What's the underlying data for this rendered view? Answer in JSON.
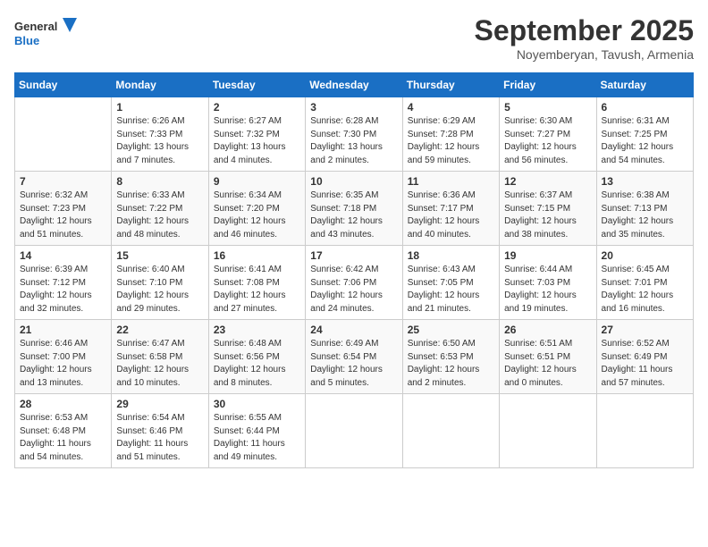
{
  "header": {
    "logo_line1": "General",
    "logo_line2": "Blue",
    "month_title": "September 2025",
    "subtitle": "Noyemberyan, Tavush, Armenia"
  },
  "days_of_week": [
    "Sunday",
    "Monday",
    "Tuesday",
    "Wednesday",
    "Thursday",
    "Friday",
    "Saturday"
  ],
  "weeks": [
    [
      {
        "day": "",
        "info": ""
      },
      {
        "day": "1",
        "info": "Sunrise: 6:26 AM\nSunset: 7:33 PM\nDaylight: 13 hours\nand 7 minutes."
      },
      {
        "day": "2",
        "info": "Sunrise: 6:27 AM\nSunset: 7:32 PM\nDaylight: 13 hours\nand 4 minutes."
      },
      {
        "day": "3",
        "info": "Sunrise: 6:28 AM\nSunset: 7:30 PM\nDaylight: 13 hours\nand 2 minutes."
      },
      {
        "day": "4",
        "info": "Sunrise: 6:29 AM\nSunset: 7:28 PM\nDaylight: 12 hours\nand 59 minutes."
      },
      {
        "day": "5",
        "info": "Sunrise: 6:30 AM\nSunset: 7:27 PM\nDaylight: 12 hours\nand 56 minutes."
      },
      {
        "day": "6",
        "info": "Sunrise: 6:31 AM\nSunset: 7:25 PM\nDaylight: 12 hours\nand 54 minutes."
      }
    ],
    [
      {
        "day": "7",
        "info": "Sunrise: 6:32 AM\nSunset: 7:23 PM\nDaylight: 12 hours\nand 51 minutes."
      },
      {
        "day": "8",
        "info": "Sunrise: 6:33 AM\nSunset: 7:22 PM\nDaylight: 12 hours\nand 48 minutes."
      },
      {
        "day": "9",
        "info": "Sunrise: 6:34 AM\nSunset: 7:20 PM\nDaylight: 12 hours\nand 46 minutes."
      },
      {
        "day": "10",
        "info": "Sunrise: 6:35 AM\nSunset: 7:18 PM\nDaylight: 12 hours\nand 43 minutes."
      },
      {
        "day": "11",
        "info": "Sunrise: 6:36 AM\nSunset: 7:17 PM\nDaylight: 12 hours\nand 40 minutes."
      },
      {
        "day": "12",
        "info": "Sunrise: 6:37 AM\nSunset: 7:15 PM\nDaylight: 12 hours\nand 38 minutes."
      },
      {
        "day": "13",
        "info": "Sunrise: 6:38 AM\nSunset: 7:13 PM\nDaylight: 12 hours\nand 35 minutes."
      }
    ],
    [
      {
        "day": "14",
        "info": "Sunrise: 6:39 AM\nSunset: 7:12 PM\nDaylight: 12 hours\nand 32 minutes."
      },
      {
        "day": "15",
        "info": "Sunrise: 6:40 AM\nSunset: 7:10 PM\nDaylight: 12 hours\nand 29 minutes."
      },
      {
        "day": "16",
        "info": "Sunrise: 6:41 AM\nSunset: 7:08 PM\nDaylight: 12 hours\nand 27 minutes."
      },
      {
        "day": "17",
        "info": "Sunrise: 6:42 AM\nSunset: 7:06 PM\nDaylight: 12 hours\nand 24 minutes."
      },
      {
        "day": "18",
        "info": "Sunrise: 6:43 AM\nSunset: 7:05 PM\nDaylight: 12 hours\nand 21 minutes."
      },
      {
        "day": "19",
        "info": "Sunrise: 6:44 AM\nSunset: 7:03 PM\nDaylight: 12 hours\nand 19 minutes."
      },
      {
        "day": "20",
        "info": "Sunrise: 6:45 AM\nSunset: 7:01 PM\nDaylight: 12 hours\nand 16 minutes."
      }
    ],
    [
      {
        "day": "21",
        "info": "Sunrise: 6:46 AM\nSunset: 7:00 PM\nDaylight: 12 hours\nand 13 minutes."
      },
      {
        "day": "22",
        "info": "Sunrise: 6:47 AM\nSunset: 6:58 PM\nDaylight: 12 hours\nand 10 minutes."
      },
      {
        "day": "23",
        "info": "Sunrise: 6:48 AM\nSunset: 6:56 PM\nDaylight: 12 hours\nand 8 minutes."
      },
      {
        "day": "24",
        "info": "Sunrise: 6:49 AM\nSunset: 6:54 PM\nDaylight: 12 hours\nand 5 minutes."
      },
      {
        "day": "25",
        "info": "Sunrise: 6:50 AM\nSunset: 6:53 PM\nDaylight: 12 hours\nand 2 minutes."
      },
      {
        "day": "26",
        "info": "Sunrise: 6:51 AM\nSunset: 6:51 PM\nDaylight: 12 hours\nand 0 minutes."
      },
      {
        "day": "27",
        "info": "Sunrise: 6:52 AM\nSunset: 6:49 PM\nDaylight: 11 hours\nand 57 minutes."
      }
    ],
    [
      {
        "day": "28",
        "info": "Sunrise: 6:53 AM\nSunset: 6:48 PM\nDaylight: 11 hours\nand 54 minutes."
      },
      {
        "day": "29",
        "info": "Sunrise: 6:54 AM\nSunset: 6:46 PM\nDaylight: 11 hours\nand 51 minutes."
      },
      {
        "day": "30",
        "info": "Sunrise: 6:55 AM\nSunset: 6:44 PM\nDaylight: 11 hours\nand 49 minutes."
      },
      {
        "day": "",
        "info": ""
      },
      {
        "day": "",
        "info": ""
      },
      {
        "day": "",
        "info": ""
      },
      {
        "day": "",
        "info": ""
      }
    ]
  ]
}
